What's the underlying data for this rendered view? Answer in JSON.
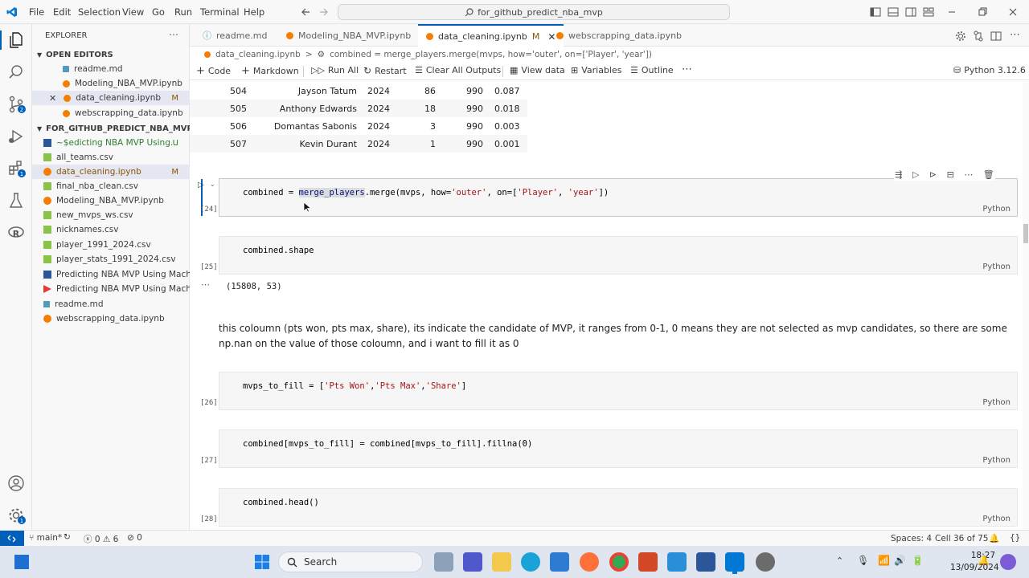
{
  "titlebar": {
    "menu": [
      "File",
      "Edit",
      "Selection",
      "View",
      "Go",
      "Run",
      "Terminal",
      "Help"
    ],
    "search": "for_github_predict_nba_mvp"
  },
  "explorer": {
    "title": "EXPLORER",
    "open_editors_title": "OPEN EDITORS",
    "open_editors": [
      {
        "name": "readme.md",
        "badge": ""
      },
      {
        "name": "Modeling_NBA_MVP.ipynb",
        "badge": ""
      },
      {
        "name": "data_cleaning.ipynb",
        "badge": "M"
      },
      {
        "name": "webscrapping_data.ipynb",
        "badge": ""
      }
    ],
    "folder_title": "FOR_GITHUB_PREDICT_NBA_MVP",
    "files": [
      {
        "name": "~$edicting NBA MVP Using...",
        "badge": "U"
      },
      {
        "name": "all_teams.csv",
        "badge": ""
      },
      {
        "name": "data_cleaning.ipynb",
        "badge": "M"
      },
      {
        "name": "final_nba_clean.csv",
        "badge": ""
      },
      {
        "name": "Modeling_NBA_MVP.ipynb",
        "badge": ""
      },
      {
        "name": "new_mvps_ws.csv",
        "badge": ""
      },
      {
        "name": "nicknames.csv",
        "badge": ""
      },
      {
        "name": "player_1991_2024.csv",
        "badge": ""
      },
      {
        "name": "player_stats_1991_2024.csv",
        "badge": ""
      },
      {
        "name": "Predicting NBA MVP Using Mach...",
        "badge": ""
      },
      {
        "name": "Predicting NBA MVP Using Mach...",
        "badge": ""
      },
      {
        "name": "readme.md",
        "badge": ""
      },
      {
        "name": "webscrapping_data.ipynb",
        "badge": ""
      }
    ]
  },
  "tabs": [
    {
      "label": "readme.md",
      "badge": ""
    },
    {
      "label": "Modeling_NBA_MVP.ipynb",
      "badge": ""
    },
    {
      "label": "data_cleaning.ipynb",
      "badge": "M"
    },
    {
      "label": "webscrapping_data.ipynb",
      "badge": ""
    }
  ],
  "breadcrumb": {
    "file": "data_cleaning.ipynb",
    "sep": ">",
    "cell": "combined = merge_players.merge(mvps, how='outer', on=['Player', 'year'])"
  },
  "toolbar": {
    "code": "Code",
    "markdown": "Markdown",
    "run_all": "Run All",
    "restart": "Restart",
    "clear": "Clear All Outputs",
    "view_data": "View data",
    "variables": "Variables",
    "outline": "Outline",
    "kernel": "Python 3.12.6"
  },
  "dataframe_rows": [
    {
      "idx": "504",
      "player": "Jayson Tatum",
      "year": "2024",
      "won": "86",
      "max": "990",
      "share": "0.087"
    },
    {
      "idx": "505",
      "player": "Anthony Edwards",
      "year": "2024",
      "won": "18",
      "max": "990",
      "share": "0.018"
    },
    {
      "idx": "506",
      "player": "Domantas Sabonis",
      "year": "2024",
      "won": "3",
      "max": "990",
      "share": "0.003"
    },
    {
      "idx": "507",
      "player": "Kevin Durant",
      "year": "2024",
      "won": "1",
      "max": "990",
      "share": "0.001"
    }
  ],
  "cells": {
    "c24": {
      "num": "[24]",
      "code_a": "combined = ",
      "code_b": "merge_players",
      "code_c": ".merge(mvps, how=",
      "code_d": "'outer'",
      "code_e": ", on=[",
      "code_f": "'Player'",
      "code_g": ", ",
      "code_h": "'year'",
      "code_i": "])",
      "lang": "Python"
    },
    "c25": {
      "num": "[25]",
      "code": "combined.shape",
      "lang": "Python",
      "output": "(15808, 53)"
    },
    "markdown": "this coloumn (pts won, pts max, share), its indicate the candidate of MVP, it ranges from 0-1, 0 means they are not selected as mvp candidates, so there are some np.nan on the value of those coloumn, and i want to fill it as 0",
    "c26": {
      "num": "[26]",
      "code_a": "mvps_to_fill = [",
      "code_b": "'Pts Won'",
      "code_c": ",",
      "code_d": "'Pts Max'",
      "code_e": ",",
      "code_f": "'Share'",
      "code_g": "]",
      "lang": "Python"
    },
    "c27": {
      "num": "[27]",
      "code": "combined[mvps_to_fill] = combined[mvps_to_fill].fillna(0)",
      "lang": "Python"
    },
    "c28": {
      "num": "[28]",
      "code": "combined.head()",
      "lang": "Python"
    }
  },
  "statusbar": {
    "branch": "main*",
    "errors": "0",
    "warnings": "6",
    "ports": "0",
    "spaces": "Spaces: 4",
    "cell": "Cell 36 of 75"
  },
  "taskbar": {
    "search": "Search",
    "time": "18:27",
    "date": "13/09/2024"
  }
}
